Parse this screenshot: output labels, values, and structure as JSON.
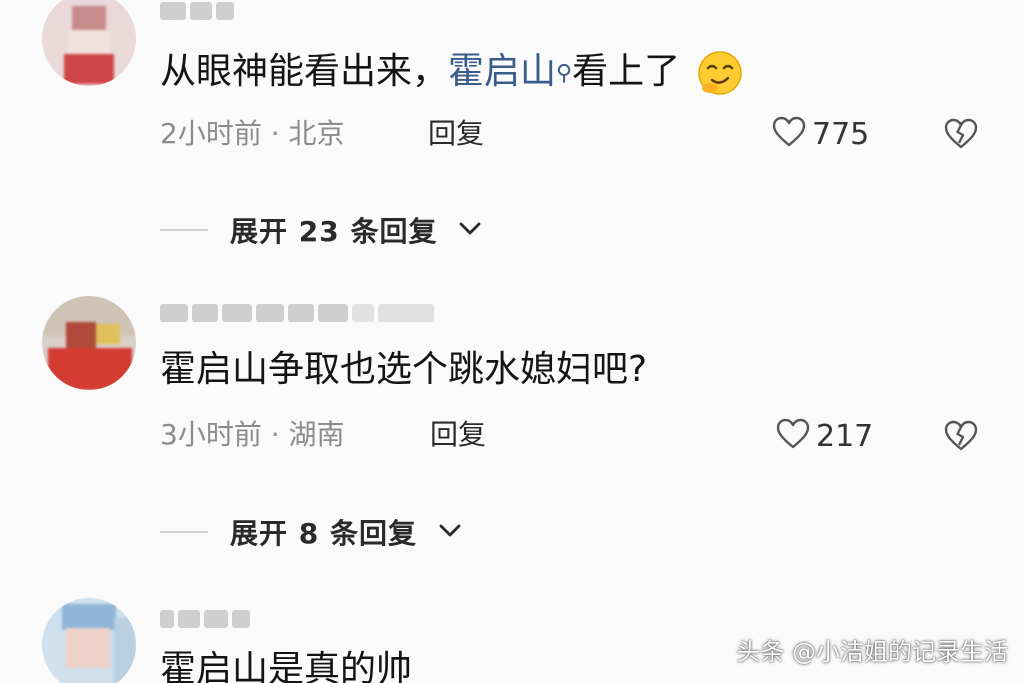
{
  "comments": [
    {
      "text_prefix": "从眼神能看出来，",
      "mention": "霍启山",
      "text_suffix": "看上了",
      "time_location": "2小时前 · 北京",
      "reply_label": "回复",
      "likes": "775",
      "expand_label": "展开 23 条回复"
    },
    {
      "text": "霍启山争取也选个跳水媳妇吧?",
      "time_location": "3小时前 · 湖南",
      "reply_label": "回复",
      "likes": "217",
      "expand_label": "展开 8 条回复"
    },
    {
      "text": "霍启山是真的帅"
    }
  ],
  "watermark": "头条 @小洁姐的记录生活",
  "colors": {
    "mention": "#3a5b8c",
    "meta": "#8c8c8c",
    "background": "#fafafa"
  },
  "icons": {
    "like": "heart-outline-icon",
    "dislike": "broken-heart-icon",
    "expand": "chevron-down-icon",
    "search": "search-icon",
    "emoji": "smirk-emoji-icon"
  }
}
